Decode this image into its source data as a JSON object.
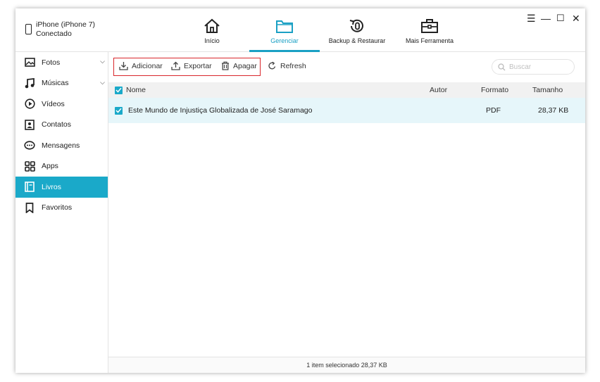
{
  "device": {
    "name": "iPhone (iPhone 7)",
    "status": "Conectado"
  },
  "nav": {
    "tabs": [
      {
        "label": "Início",
        "icon": "home-icon"
      },
      {
        "label": "Gerenciar",
        "icon": "folder-icon",
        "active": true
      },
      {
        "label": "Backup & Restaurar",
        "icon": "backup-restore-icon"
      },
      {
        "label": "Mais Ferramenta",
        "icon": "toolbox-icon"
      }
    ]
  },
  "window_controls": {
    "menu": "☰",
    "minimize": "—",
    "maximize": "☐",
    "close": "✕"
  },
  "sidebar": {
    "items": [
      {
        "label": "Fotos",
        "icon": "photo-icon",
        "expandable": true
      },
      {
        "label": "Músicas",
        "icon": "music-icon",
        "expandable": true
      },
      {
        "label": "Vídeos",
        "icon": "video-icon"
      },
      {
        "label": "Contatos",
        "icon": "contacts-icon"
      },
      {
        "label": "Mensagens",
        "icon": "messages-icon"
      },
      {
        "label": "Apps",
        "icon": "apps-icon"
      },
      {
        "label": "Livros",
        "icon": "books-icon",
        "active": true
      },
      {
        "label": "Favoritos",
        "icon": "bookmark-icon"
      }
    ]
  },
  "toolbar": {
    "add_label": "Adicionar",
    "export_label": "Exportar",
    "delete_label": "Apagar",
    "refresh_label": "Refresh",
    "search_placeholder": "Buscar"
  },
  "table": {
    "columns": {
      "name": "Nome",
      "author": "Autor",
      "format": "Formato",
      "size": "Tamanho"
    },
    "rows": [
      {
        "name": "Este Mundo de Injustiça Globalizada de José Saramago",
        "author": "",
        "format": "PDF",
        "size": "28,37 KB",
        "checked": true
      }
    ]
  },
  "status": {
    "text": "1 item selecionado 28,37 KB"
  },
  "colors": {
    "accent": "#1aa9c9",
    "highlight_box": "#d9262b",
    "selected_row": "#e6f6fa"
  }
}
